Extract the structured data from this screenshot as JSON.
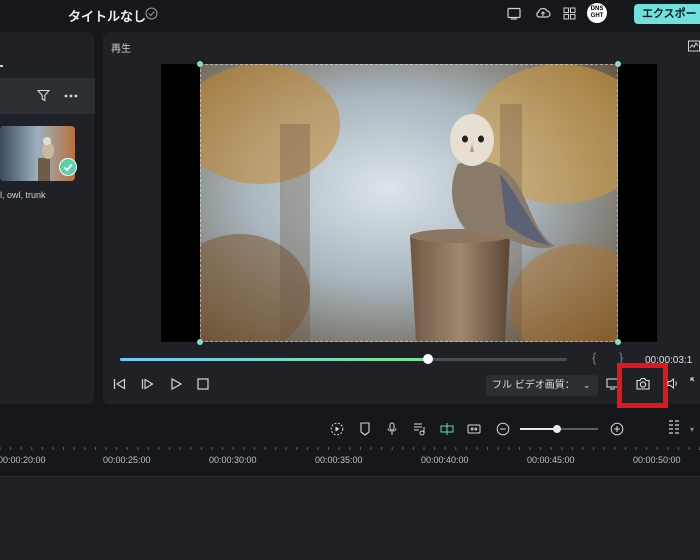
{
  "header": {
    "project_title": "タイトルなし",
    "export_label": "エクスポート",
    "avatar_text": "DNS GHT"
  },
  "media": {
    "thumbnail_tags": "l, owl, trunk"
  },
  "player": {
    "panel_label": "再生",
    "timecode": "00:00:03:1",
    "quality_label": "フル ビデオ画質：",
    "progress": 0.69
  },
  "timeline": {
    "ruler_labels": [
      "00:00:20:00",
      "00:00:25:00",
      "00:00:30:00",
      "00:00:35:00",
      "00:00:40:00",
      "00:00:45:00",
      "00:00:50:00"
    ],
    "zoom_level": 0.47
  },
  "colors": {
    "accent": "#6fe0dc",
    "progress_start": "#72c8ff",
    "progress_end": "#7fe08f",
    "highlight": "#e8141b"
  }
}
